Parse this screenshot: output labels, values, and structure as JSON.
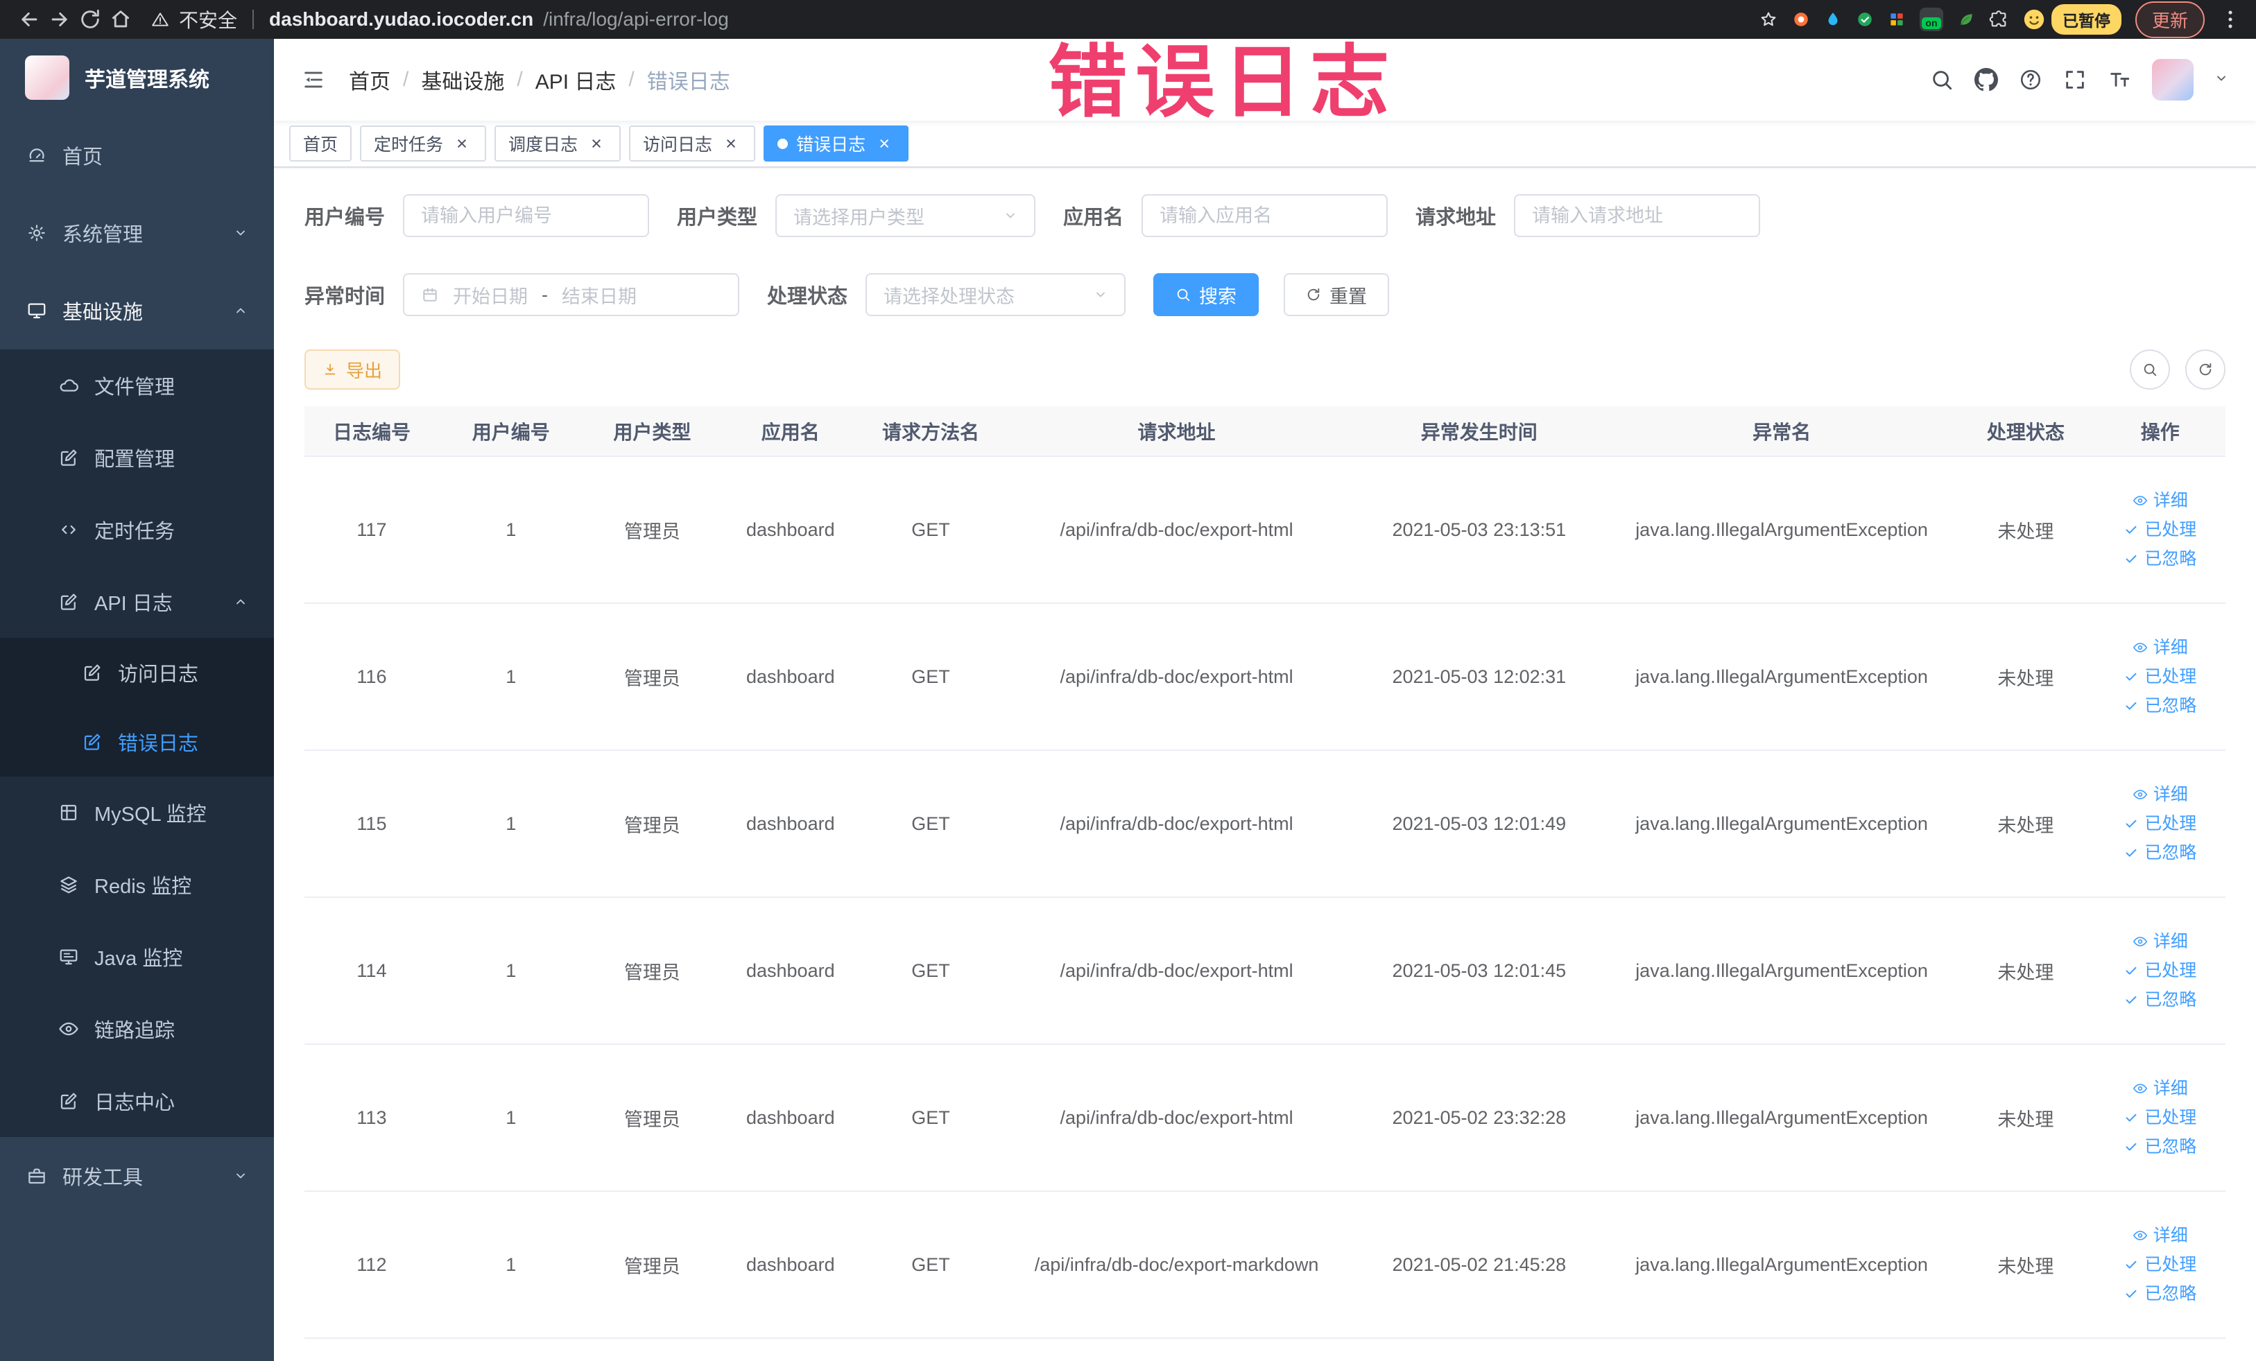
{
  "annotation": {
    "text": "错误日志"
  },
  "browser": {
    "security_label": "不安全",
    "url_host": "dashboard.yudao.iocoder.cn",
    "url_path": "/infra/log/api-error-log",
    "on_badge": "on",
    "paused_badge": "已暂停",
    "update_label": "更新"
  },
  "sidebar": {
    "title": "芋道管理系统",
    "items": {
      "home": "首页",
      "system": "系统管理",
      "infra": "基础设施",
      "file": "文件管理",
      "config": "配置管理",
      "job": "定时任务",
      "api_log": "API 日志",
      "access_log": "访问日志",
      "error_log": "错误日志",
      "mysql": "MySQL 监控",
      "redis": "Redis 监控",
      "java": "Java 监控",
      "trace": "链路追踪",
      "log_center": "日志中心",
      "dev_tools": "研发工具"
    }
  },
  "breadcrumb": {
    "separator": "/",
    "items": [
      "首页",
      "基础设施",
      "API 日志",
      "错误日志"
    ]
  },
  "tabs": [
    {
      "label": "首页"
    },
    {
      "label": "定时任务"
    },
    {
      "label": "调度日志"
    },
    {
      "label": "访问日志"
    },
    {
      "label": "错误日志"
    }
  ],
  "filters": {
    "user_id": {
      "label": "用户编号",
      "placeholder": "请输入用户编号"
    },
    "user_type": {
      "label": "用户类型",
      "placeholder": "请选择用户类型"
    },
    "app_name": {
      "label": "应用名",
      "placeholder": "请输入应用名"
    },
    "request_url": {
      "label": "请求地址",
      "placeholder": "请输入请求地址"
    },
    "exception_time": {
      "label": "异常时间",
      "start_placeholder": "开始日期",
      "separator": "-",
      "end_placeholder": "结束日期"
    },
    "process_status": {
      "label": "处理状态",
      "placeholder": "请选择处理状态"
    },
    "search_label": "搜索",
    "reset_label": "重置"
  },
  "toolbar": {
    "export_label": "导出"
  },
  "table": {
    "columns": [
      "日志编号",
      "用户编号",
      "用户类型",
      "应用名",
      "请求方法名",
      "请求地址",
      "异常发生时间",
      "异常名",
      "处理状态",
      "操作"
    ],
    "actions": {
      "detail": "详细",
      "processed": "已处理",
      "ignored": "已忽略"
    },
    "rows": [
      {
        "log_id": "117",
        "user_id": "1",
        "user_type": "管理员",
        "app_name": "dashboard",
        "method": "GET",
        "url": "/api/infra/db-doc/export-html",
        "time": "2021-05-03 23:13:51",
        "exception": "java.lang.IllegalArgumentException",
        "status": "未处理"
      },
      {
        "log_id": "116",
        "user_id": "1",
        "user_type": "管理员",
        "app_name": "dashboard",
        "method": "GET",
        "url": "/api/infra/db-doc/export-html",
        "time": "2021-05-03 12:02:31",
        "exception": "java.lang.IllegalArgumentException",
        "status": "未处理"
      },
      {
        "log_id": "115",
        "user_id": "1",
        "user_type": "管理员",
        "app_name": "dashboard",
        "method": "GET",
        "url": "/api/infra/db-doc/export-html",
        "time": "2021-05-03 12:01:49",
        "exception": "java.lang.IllegalArgumentException",
        "status": "未处理"
      },
      {
        "log_id": "114",
        "user_id": "1",
        "user_type": "管理员",
        "app_name": "dashboard",
        "method": "GET",
        "url": "/api/infra/db-doc/export-html",
        "time": "2021-05-03 12:01:45",
        "exception": "java.lang.IllegalArgumentException",
        "status": "未处理"
      },
      {
        "log_id": "113",
        "user_id": "1",
        "user_type": "管理员",
        "app_name": "dashboard",
        "method": "GET",
        "url": "/api/infra/db-doc/export-html",
        "time": "2021-05-02 23:32:28",
        "exception": "java.lang.IllegalArgumentException",
        "status": "未处理"
      },
      {
        "log_id": "112",
        "user_id": "1",
        "user_type": "管理员",
        "app_name": "dashboard",
        "method": "GET",
        "url": "/api/infra/db-doc/export-markdown",
        "time": "2021-05-02 21:45:28",
        "exception": "java.lang.IllegalArgumentException",
        "status": "未处理"
      }
    ]
  }
}
